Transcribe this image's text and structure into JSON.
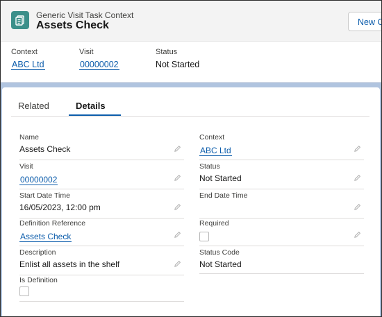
{
  "header": {
    "object_type": "Generic Visit Task Context",
    "title": "Assets Check",
    "new_button_label": "New Co",
    "icon": "task-context-icon",
    "highlights": [
      {
        "label": "Context",
        "value": "ABC Ltd",
        "is_link": true
      },
      {
        "label": "Visit",
        "value": "00000002",
        "is_link": true
      },
      {
        "label": "Status",
        "value": "Not Started",
        "is_link": false
      }
    ]
  },
  "tabs": [
    {
      "label": "Related",
      "active": false
    },
    {
      "label": "Details",
      "active": true
    }
  ],
  "details": {
    "left": [
      {
        "label": "Name",
        "value": "Assets Check",
        "is_link": false
      },
      {
        "label": "Visit",
        "value": "00000002",
        "is_link": true
      },
      {
        "label": "Start Date Time",
        "value": "16/05/2023, 12:00 pm",
        "is_link": false
      },
      {
        "label": "Definition Reference",
        "value": "Assets Check",
        "is_link": true
      },
      {
        "label": "Description",
        "value": "Enlist all assets in the shelf",
        "is_link": false
      },
      {
        "label": "Is Definition",
        "checked": false
      }
    ],
    "right": [
      {
        "label": "Context",
        "value": "ABC Ltd",
        "is_link": true
      },
      {
        "label": "Status",
        "value": "Not Started",
        "is_link": false
      },
      {
        "label": "End Date Time",
        "value": "",
        "is_link": false
      },
      {
        "label": "Required",
        "checked": false
      },
      {
        "label": "Status Code",
        "value": "Not Started",
        "is_link": false
      }
    ]
  },
  "colors": {
    "accent": "#0b5cab",
    "icon_bg": "#3c8f8a",
    "page_bg": "#b0c4df"
  }
}
